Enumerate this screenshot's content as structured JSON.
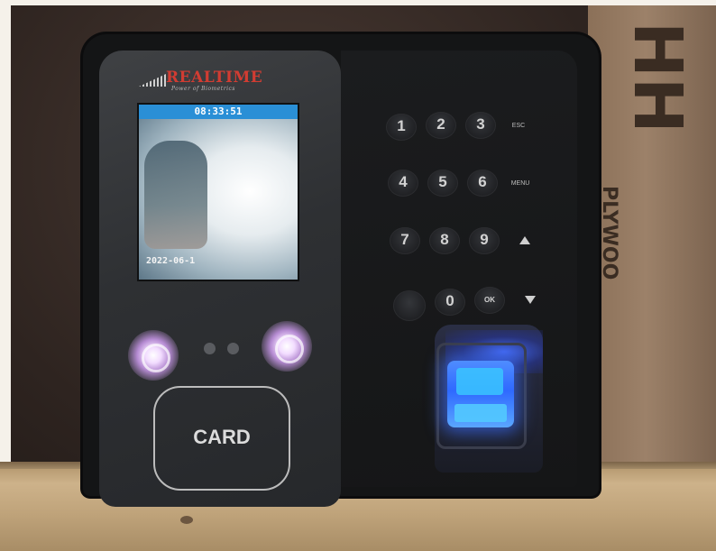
{
  "device": {
    "brand": "REALTIME",
    "tagline": "Power of Biometrics",
    "screen": {
      "time": "08:33:51",
      "date": "2022-06-1"
    },
    "card_label": "CARD"
  },
  "keypad": {
    "keys": [
      "1",
      "2",
      "3",
      "ESC",
      "4",
      "5",
      "6",
      "MENU",
      "7",
      "8",
      "9",
      "",
      "0",
      "OK"
    ]
  },
  "box": {
    "text_big": "HH",
    "text_small": "PLYWOO"
  },
  "colors": {
    "accent_blue": "#2f69ff",
    "brand_red": "#d23c32",
    "ir_glow": "#f2dcff"
  }
}
